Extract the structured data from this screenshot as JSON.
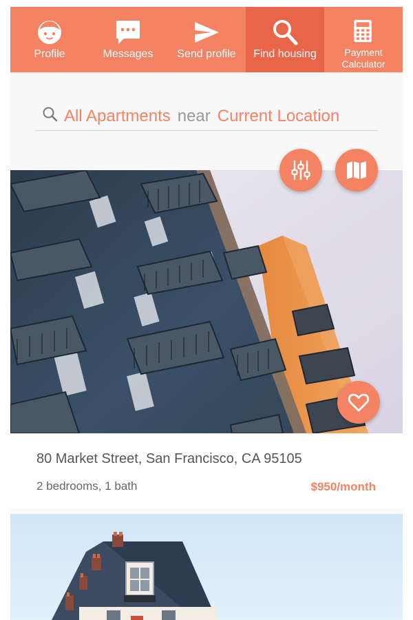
{
  "nav": {
    "items": [
      {
        "label": "Profile",
        "icon": "face-icon",
        "active": false
      },
      {
        "label": "Messages",
        "icon": "chat-bubble-icon",
        "active": false
      },
      {
        "label": "Send profile",
        "icon": "send-icon",
        "active": false
      },
      {
        "label": "Find housing",
        "icon": "search-icon",
        "active": true
      },
      {
        "label": "Payment Calculator",
        "icon": "calculator-icon",
        "active": false
      }
    ]
  },
  "search": {
    "type": "All Apartments",
    "connector": "near",
    "location": "Current Location",
    "icon": "search-icon"
  },
  "actions": {
    "filter_icon": "sliders-icon",
    "map_icon": "map-icon",
    "favorite_icon": "heart-icon"
  },
  "listings": [
    {
      "address": "80 Market Street, San Francisco, CA 95105",
      "details": "2 bedrooms, 1 bath",
      "price": "$950/month",
      "photo": "apartment-building-photo"
    },
    {
      "photo": "building-rooftop-photo"
    }
  ],
  "colors": {
    "accent": "#F38363",
    "accent_active": "#E8654A",
    "search_background": "#f8f8f8"
  }
}
